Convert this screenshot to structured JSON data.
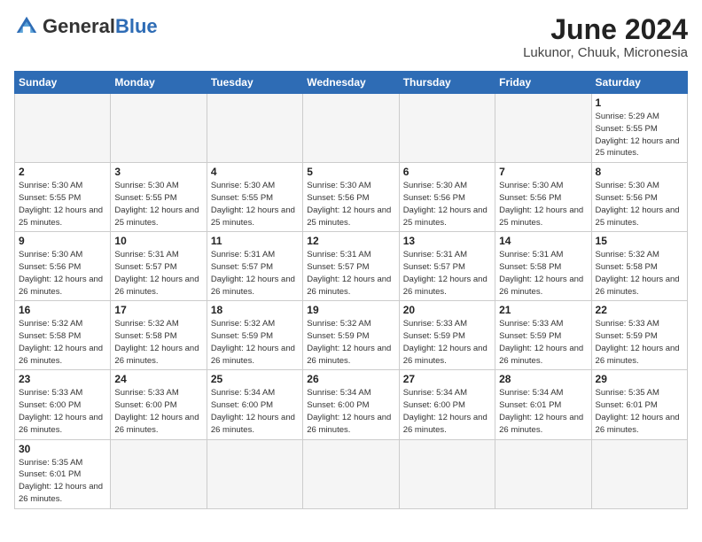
{
  "header": {
    "logo_general": "General",
    "logo_blue": "Blue",
    "month_title": "June 2024",
    "location": "Lukunor, Chuuk, Micronesia"
  },
  "days_of_week": [
    "Sunday",
    "Monday",
    "Tuesday",
    "Wednesday",
    "Thursday",
    "Friday",
    "Saturday"
  ],
  "weeks": [
    [
      {
        "day": null,
        "info": null
      },
      {
        "day": null,
        "info": null
      },
      {
        "day": null,
        "info": null
      },
      {
        "day": null,
        "info": null
      },
      {
        "day": null,
        "info": null
      },
      {
        "day": null,
        "info": null
      },
      {
        "day": "1",
        "info": "Sunrise: 5:29 AM\nSunset: 5:55 PM\nDaylight: 12 hours and 25 minutes."
      }
    ],
    [
      {
        "day": "2",
        "info": "Sunrise: 5:30 AM\nSunset: 5:55 PM\nDaylight: 12 hours and 25 minutes."
      },
      {
        "day": "3",
        "info": "Sunrise: 5:30 AM\nSunset: 5:55 PM\nDaylight: 12 hours and 25 minutes."
      },
      {
        "day": "4",
        "info": "Sunrise: 5:30 AM\nSunset: 5:55 PM\nDaylight: 12 hours and 25 minutes."
      },
      {
        "day": "5",
        "info": "Sunrise: 5:30 AM\nSunset: 5:56 PM\nDaylight: 12 hours and 25 minutes."
      },
      {
        "day": "6",
        "info": "Sunrise: 5:30 AM\nSunset: 5:56 PM\nDaylight: 12 hours and 25 minutes."
      },
      {
        "day": "7",
        "info": "Sunrise: 5:30 AM\nSunset: 5:56 PM\nDaylight: 12 hours and 25 minutes."
      },
      {
        "day": "8",
        "info": "Sunrise: 5:30 AM\nSunset: 5:56 PM\nDaylight: 12 hours and 25 minutes."
      }
    ],
    [
      {
        "day": "9",
        "info": "Sunrise: 5:30 AM\nSunset: 5:56 PM\nDaylight: 12 hours and 26 minutes."
      },
      {
        "day": "10",
        "info": "Sunrise: 5:31 AM\nSunset: 5:57 PM\nDaylight: 12 hours and 26 minutes."
      },
      {
        "day": "11",
        "info": "Sunrise: 5:31 AM\nSunset: 5:57 PM\nDaylight: 12 hours and 26 minutes."
      },
      {
        "day": "12",
        "info": "Sunrise: 5:31 AM\nSunset: 5:57 PM\nDaylight: 12 hours and 26 minutes."
      },
      {
        "day": "13",
        "info": "Sunrise: 5:31 AM\nSunset: 5:57 PM\nDaylight: 12 hours and 26 minutes."
      },
      {
        "day": "14",
        "info": "Sunrise: 5:31 AM\nSunset: 5:58 PM\nDaylight: 12 hours and 26 minutes."
      },
      {
        "day": "15",
        "info": "Sunrise: 5:32 AM\nSunset: 5:58 PM\nDaylight: 12 hours and 26 minutes."
      }
    ],
    [
      {
        "day": "16",
        "info": "Sunrise: 5:32 AM\nSunset: 5:58 PM\nDaylight: 12 hours and 26 minutes."
      },
      {
        "day": "17",
        "info": "Sunrise: 5:32 AM\nSunset: 5:58 PM\nDaylight: 12 hours and 26 minutes."
      },
      {
        "day": "18",
        "info": "Sunrise: 5:32 AM\nSunset: 5:59 PM\nDaylight: 12 hours and 26 minutes."
      },
      {
        "day": "19",
        "info": "Sunrise: 5:32 AM\nSunset: 5:59 PM\nDaylight: 12 hours and 26 minutes."
      },
      {
        "day": "20",
        "info": "Sunrise: 5:33 AM\nSunset: 5:59 PM\nDaylight: 12 hours and 26 minutes."
      },
      {
        "day": "21",
        "info": "Sunrise: 5:33 AM\nSunset: 5:59 PM\nDaylight: 12 hours and 26 minutes."
      },
      {
        "day": "22",
        "info": "Sunrise: 5:33 AM\nSunset: 5:59 PM\nDaylight: 12 hours and 26 minutes."
      }
    ],
    [
      {
        "day": "23",
        "info": "Sunrise: 5:33 AM\nSunset: 6:00 PM\nDaylight: 12 hours and 26 minutes."
      },
      {
        "day": "24",
        "info": "Sunrise: 5:33 AM\nSunset: 6:00 PM\nDaylight: 12 hours and 26 minutes."
      },
      {
        "day": "25",
        "info": "Sunrise: 5:34 AM\nSunset: 6:00 PM\nDaylight: 12 hours and 26 minutes."
      },
      {
        "day": "26",
        "info": "Sunrise: 5:34 AM\nSunset: 6:00 PM\nDaylight: 12 hours and 26 minutes."
      },
      {
        "day": "27",
        "info": "Sunrise: 5:34 AM\nSunset: 6:00 PM\nDaylight: 12 hours and 26 minutes."
      },
      {
        "day": "28",
        "info": "Sunrise: 5:34 AM\nSunset: 6:01 PM\nDaylight: 12 hours and 26 minutes."
      },
      {
        "day": "29",
        "info": "Sunrise: 5:35 AM\nSunset: 6:01 PM\nDaylight: 12 hours and 26 minutes."
      }
    ],
    [
      {
        "day": "30",
        "info": "Sunrise: 5:35 AM\nSunset: 6:01 PM\nDaylight: 12 hours and 26 minutes."
      },
      {
        "day": null,
        "info": null
      },
      {
        "day": null,
        "info": null
      },
      {
        "day": null,
        "info": null
      },
      {
        "day": null,
        "info": null
      },
      {
        "day": null,
        "info": null
      },
      {
        "day": null,
        "info": null
      }
    ]
  ]
}
